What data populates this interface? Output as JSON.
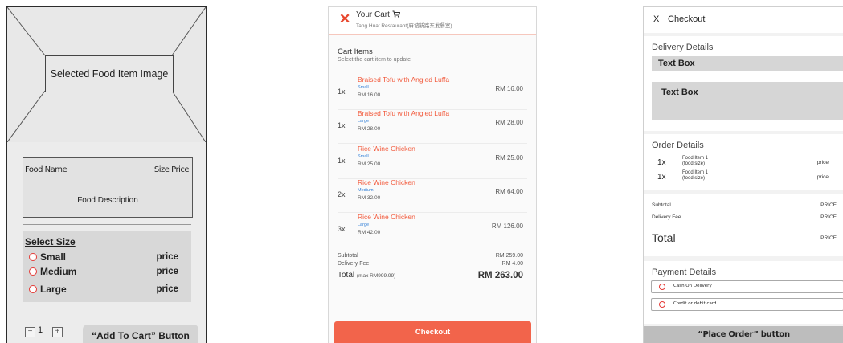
{
  "wireframe": {
    "image_label": "Selected Food Item Image",
    "food_name": "Food Name",
    "size_price": "Size Price",
    "food_description": "Food Description",
    "select_size_title": "Select Size",
    "sizes": [
      {
        "label": "Small",
        "price": "price"
      },
      {
        "label": "Medium",
        "price": "price"
      },
      {
        "label": "Large",
        "price": "price"
      }
    ],
    "quantity": "1",
    "minus_icon": "minus-box-icon",
    "plus_icon": "plus-box-icon",
    "add_to_cart_label": "“Add To Cart” Button",
    "radio_color": "#e53935"
  },
  "cart": {
    "close_symbol": "✕",
    "title": "Your Cart",
    "cart_icon": "shopping-cart-icon",
    "restaurant": "Tang Huat Restaurant(麻坡新路东发餐室)",
    "items_title": "Cart Items",
    "items_subtitle": "Select the cart item to update",
    "items": [
      {
        "qty": "1x",
        "name": "Braised Tofu with Angled Luffa",
        "size": "Small",
        "unit_price": "RM 16.00",
        "total": "RM 16.00"
      },
      {
        "qty": "1x",
        "name": "Braised Tofu with Angled Luffa",
        "size": "Large",
        "unit_price": "RM 28.00",
        "total": "RM 28.00"
      },
      {
        "qty": "1x",
        "name": "Rice Wine Chicken",
        "size": "Small",
        "unit_price": "RM 25.00",
        "total": "RM 25.00"
      },
      {
        "qty": "2x",
        "name": "Rice Wine Chicken",
        "size": "Medium",
        "unit_price": "RM 32.00",
        "total": "RM 64.00"
      },
      {
        "qty": "3x",
        "name": "Rice Wine Chicken",
        "size": "Large",
        "unit_price": "RM 42.00",
        "total": "RM 126.00"
      }
    ],
    "subtotal_label": "Subtotal",
    "subtotal_value": "RM 259.00",
    "delivery_label": "Delivery Fee",
    "delivery_value": "RM 4.00",
    "total_label": "Total",
    "total_note": "(max RM999.99)",
    "total_value": "RM 263.00",
    "checkout_label": "Checkout",
    "accent_color": "#f2644b",
    "size_color": "#2a7bd6"
  },
  "checkout": {
    "close_symbol": "X",
    "title": "Checkout",
    "delivery_title": "Delivery Details",
    "text_box_1": "Text Box",
    "text_box_2": "Text Box",
    "order_title": "Order Details",
    "order_items": [
      {
        "qty": "1x",
        "name": "Food Item 1",
        "size": "(food size)",
        "price": "price"
      },
      {
        "qty": "1x",
        "name": "Food Item 1",
        "size": "(food size)",
        "price": "price"
      }
    ],
    "subtotal_label": "Subtotal",
    "subtotal_value": "PRICE",
    "delivery_label": "Delivery Fee",
    "delivery_value": "PRICE",
    "total_label": "Total",
    "total_value": "PRICE",
    "payment_title": "Payment Details",
    "payment_options": [
      "Cash On Delivery",
      "Credit or debit card"
    ],
    "place_order_label": "“Place Order” button"
  }
}
